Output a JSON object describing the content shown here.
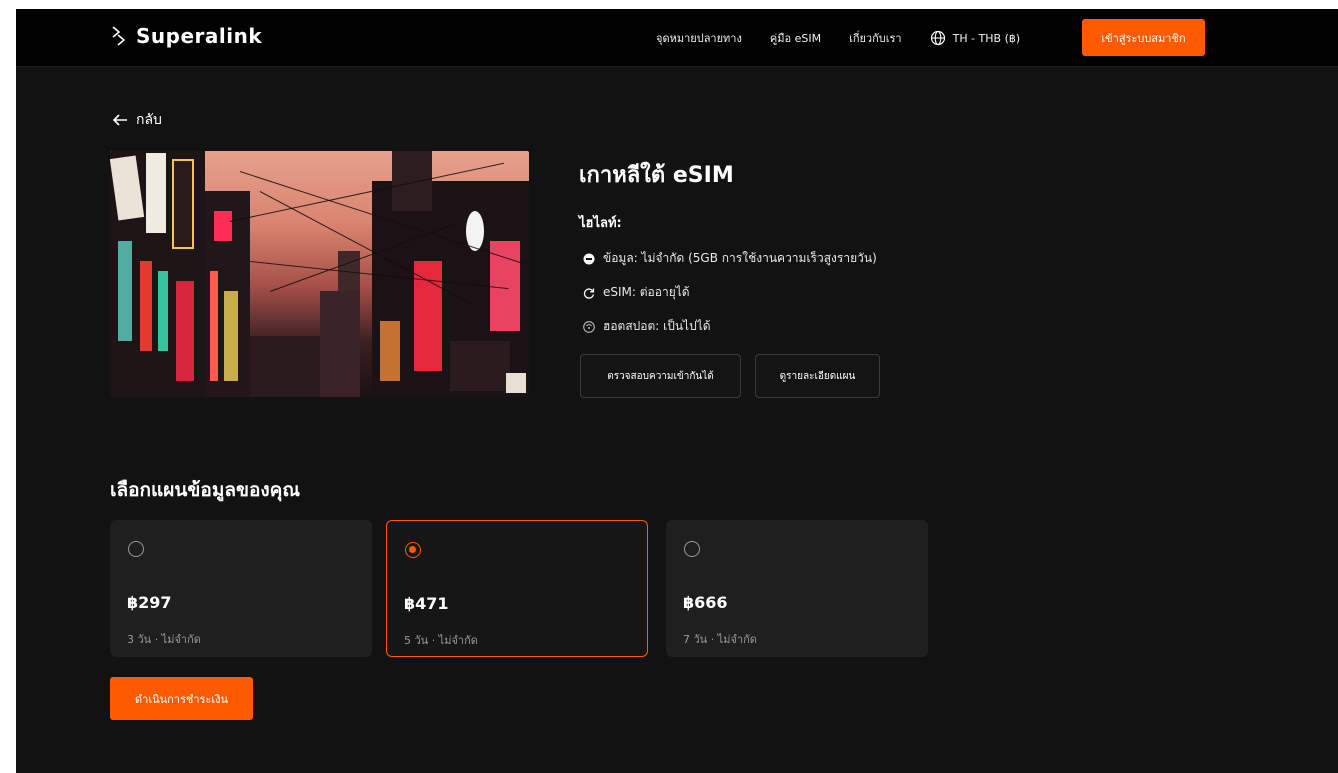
{
  "brand": {
    "name": "Superalink",
    "accent": "#ff5a00"
  },
  "nav": {
    "links": [
      "จุดหมายปลายทาง",
      "คู่มือ eSIM",
      "เกี่ยวกับเรา"
    ],
    "language": "TH - THB (฿)",
    "join_label": "เข้าสู่ระบบสมาชิก"
  },
  "back_label": "กลับ",
  "product": {
    "image_icon": "seoul-street-night-image",
    "title": "เกาหลีใต้ eSIM",
    "highlights_label": "ไฮไลท์:",
    "features": [
      {
        "icon": "data-icon",
        "text": "ข้อมูล: ไม่จำกัด (5GB การใช้งานความเร็วสูงรายวัน)"
      },
      {
        "icon": "refresh-icon",
        "text": "eSIM: ต่ออายุได้"
      },
      {
        "icon": "hotspot-icon",
        "text": "ฮอตสปอต: เป็นไปได้"
      }
    ],
    "check_compat_label": "ตรวจสอบความเข้ากันได้",
    "view_plan_label": "ดูรายละเอียดแผน"
  },
  "plans_title": "เลือกแผนข้อมูลของคุณ",
  "plans": [
    {
      "price": "฿297",
      "meta": "3 วัน · ไม่จำกัด",
      "selected": false
    },
    {
      "price": "฿471",
      "meta": "5 วัน · ไม่จำกัด",
      "selected": true
    },
    {
      "price": "฿666",
      "meta": "7 วัน · ไม่จำกัด",
      "selected": false
    }
  ],
  "pay_label": "ดำเนินการชำระเงิน"
}
